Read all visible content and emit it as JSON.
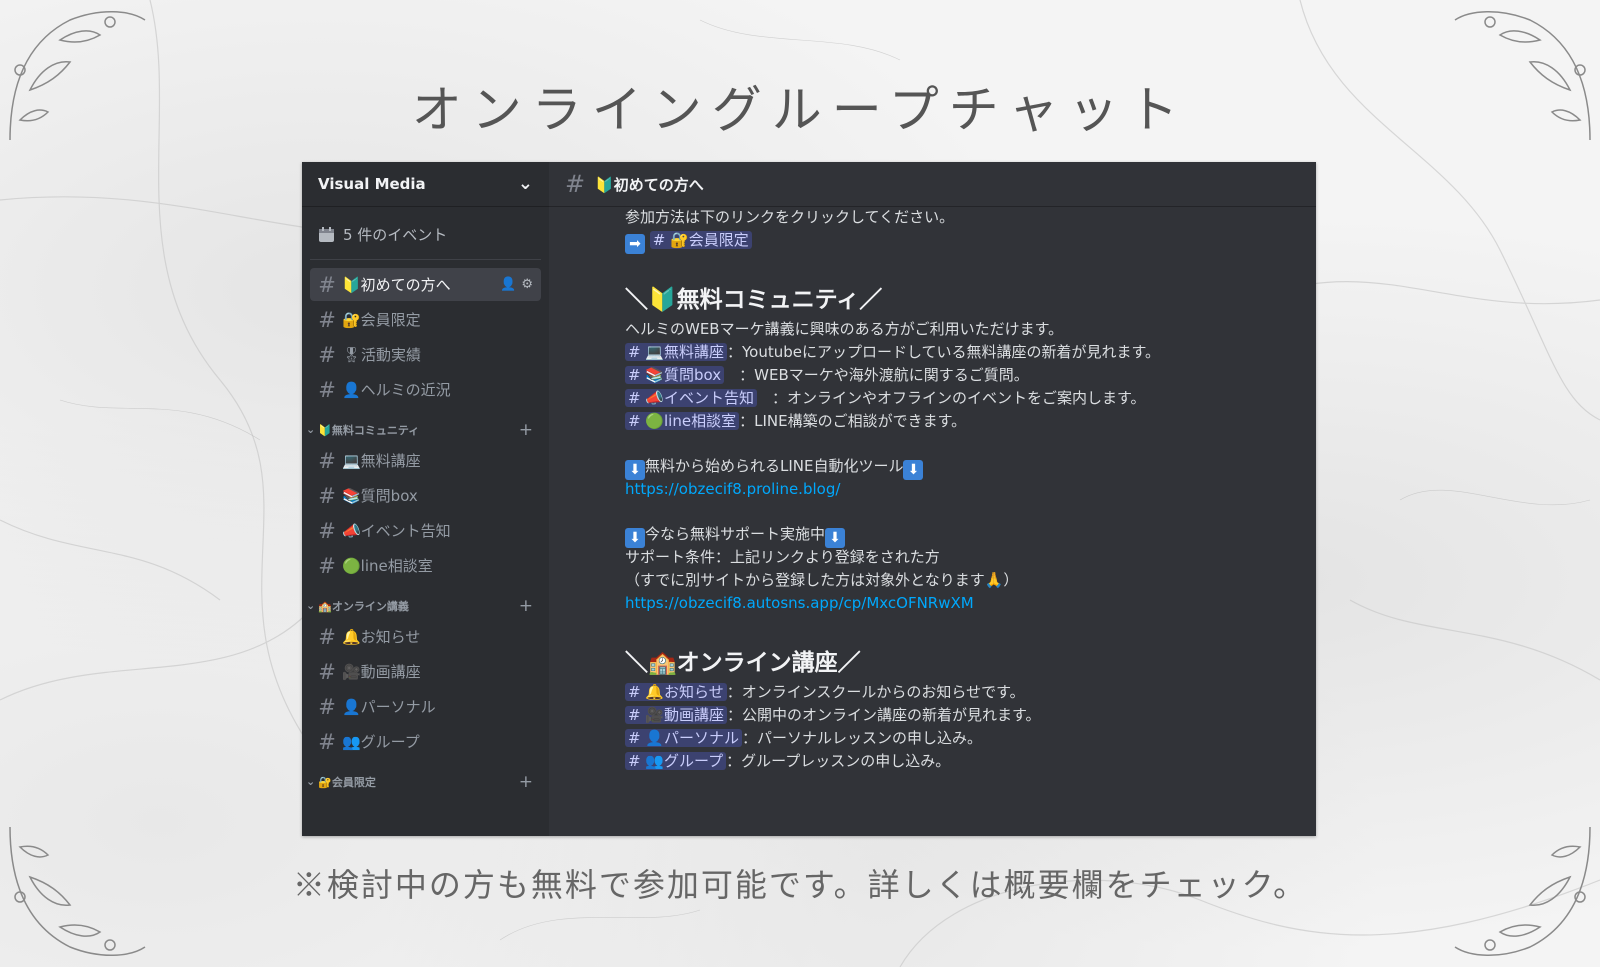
{
  "page": {
    "title": "オンライングループチャット",
    "caption": "※検討中の方も無料で参加可能です。詳しくは概要欄をチェック。"
  },
  "sidebar": {
    "server_name": "Visual Media",
    "events_label": "5 件のイベント",
    "top_channels": [
      {
        "label": "🔰初めての方へ",
        "active": true
      },
      {
        "label": "🔐会員限定"
      },
      {
        "label": "🎖活動実績"
      },
      {
        "label": "👤ヘルミの近況"
      }
    ],
    "categories": [
      {
        "label": "🔰無料コミュニティ",
        "channels": [
          "💻無料講座",
          "📚質問box",
          "📣イベント告知",
          "🟢line相談室"
        ]
      },
      {
        "label": "🏫オンライン講義",
        "channels": [
          "🔔お知らせ",
          "🎥動画講座",
          "👤パーソナル",
          "👥グループ"
        ]
      },
      {
        "label": "🔐会員限定",
        "channels": []
      }
    ]
  },
  "main": {
    "channel_title": "🔰初めての方へ",
    "intro_line": "参加方法は下のリンクをクリックしてください。",
    "intro_mention": "# 🔐会員限定",
    "section1": {
      "heading": "＼🔰無料コミュニティ／",
      "lead": "ヘルミのWEBマーケ講義に興味のある方がご利用いただけます。",
      "items": [
        {
          "mention": "# 💻無料講座",
          "text": "：Youtubeにアップロードしている無料講座の新着が見れます。"
        },
        {
          "mention": "# 📚質問box",
          "text": "　：WEBマーケや海外渡航に関するご質問。"
        },
        {
          "mention": "# 📣イベント告知",
          "text": "　：オンラインやオフラインのイベントをご案内します。"
        },
        {
          "mention": "# 🟢line相談室",
          "text": "：LINE構築のご相談ができます。"
        }
      ]
    },
    "tool_line": "無料から始められるLINE自動化ツール",
    "tool_url": "https://obzecif8.proline.blog/",
    "support_line": "今なら無料サポート実施中",
    "support_cond": "サポート条件：上記リンクより登録をされた方",
    "support_note": "（すでに別サイトから登録した方は対象外となります🙏）",
    "support_url": "https://obzecif8.autosns.app/cp/MxcOFNRwXM",
    "section2": {
      "heading": "＼🏫オンライン講座／",
      "items": [
        {
          "mention": "# 🔔お知らせ",
          "text": "：オンラインスクールからのお知らせです。"
        },
        {
          "mention": "# 🎥動画講座",
          "text": "：公開中のオンライン講座の新着が見れます。"
        },
        {
          "mention": "# 👤パーソナル",
          "text": "：パーソナルレッスンの申し込み。"
        },
        {
          "mention": "# 👥グループ",
          "text": "：グループレッスンの申し込み。"
        }
      ]
    }
  },
  "icons": {
    "hash": "#",
    "arrow_right": "➡",
    "arrow_down": "⬇",
    "chevron": "⌄",
    "plus": "+",
    "calendar": "calendar-icon"
  },
  "colors": {
    "sidebar_bg": "#2b2d31",
    "chat_bg": "#313338",
    "mention_bg": "#3c4270",
    "link": "#00a8fc"
  }
}
